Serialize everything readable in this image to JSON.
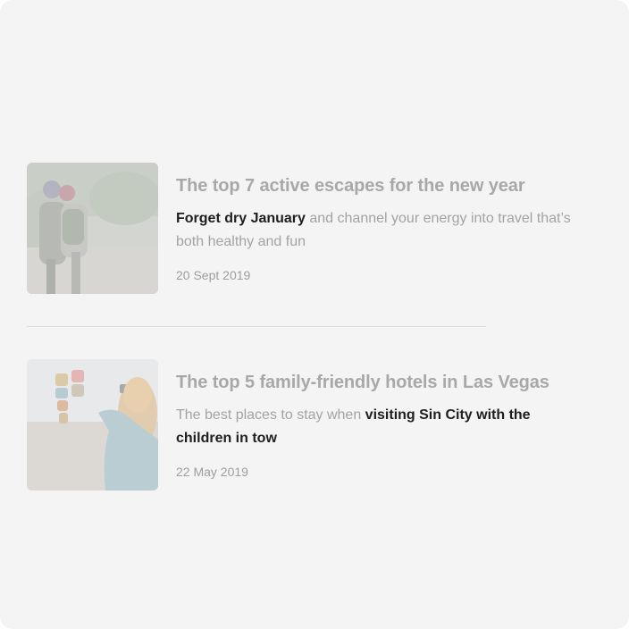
{
  "articles": [
    {
      "title": "The top 7 active escapes for the new year",
      "desc_highlight": "Forget dry January",
      "desc_rest": " and channel your energy into travel that’s both healthy and fun",
      "date": "20 Sept 2019"
    },
    {
      "title": "The top 5 family-friendly hotels in Las Vegas",
      "desc_lead": "The best places to stay when ",
      "desc_highlight": "visiting Sin City with the children in tow",
      "date": "22 May 2019"
    }
  ]
}
